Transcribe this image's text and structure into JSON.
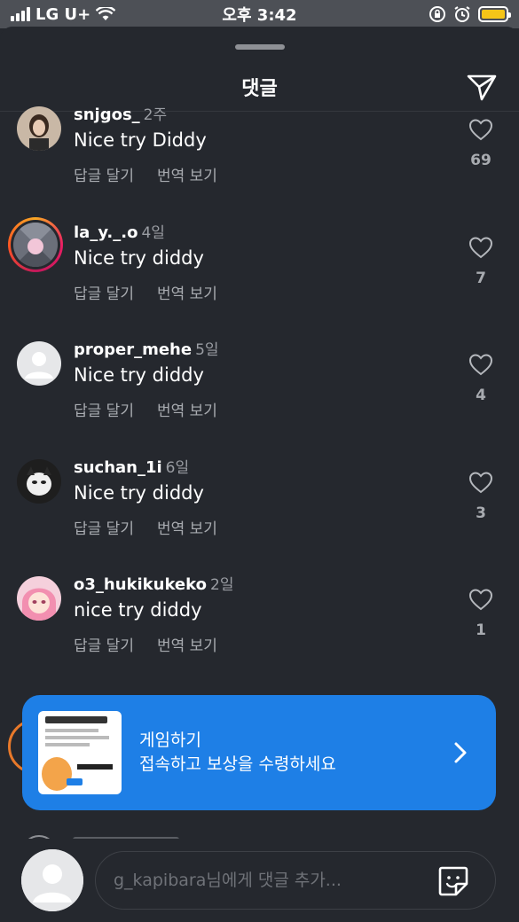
{
  "status_bar": {
    "carrier": "LG U+",
    "time": "오후 3:42",
    "battery_color": "#f5c518"
  },
  "sheet": {
    "title": "댓글",
    "send_icon": "paper-plane-icon"
  },
  "comments": [
    {
      "username": "snjgos_",
      "time": "2주",
      "text": "Nice try Diddy",
      "reply_label": "답글 달기",
      "translate_label": "번역 보기",
      "likes": "69",
      "story_ring": false
    },
    {
      "username": "la_y._.o",
      "time": "4일",
      "text": "Nice try diddy",
      "reply_label": "답글 달기",
      "translate_label": "번역 보기",
      "likes": "7",
      "story_ring": true
    },
    {
      "username": "proper_mehe",
      "time": "5일",
      "text": "Nice try diddy",
      "reply_label": "답글 달기",
      "translate_label": "번역 보기",
      "likes": "4",
      "story_ring": false
    },
    {
      "username": "suchan_1i",
      "time": "6일",
      "text": "Nice try diddy",
      "reply_label": "답글 달기",
      "translate_label": "번역 보기",
      "likes": "3",
      "story_ring": false
    },
    {
      "username": "o3_hukikukeko",
      "time": "2일",
      "text": "nice try diddy",
      "reply_label": "답글 달기",
      "translate_label": "번역 보기",
      "likes": "1",
      "story_ring": false
    }
  ],
  "promo": {
    "title": "게임하기",
    "subtitle": "접속하고 보상을 수령하세요",
    "color": "#1e7fe6"
  },
  "comment_input": {
    "placeholder": "g_kapibara님에게 댓글 추가...",
    "value": ""
  }
}
